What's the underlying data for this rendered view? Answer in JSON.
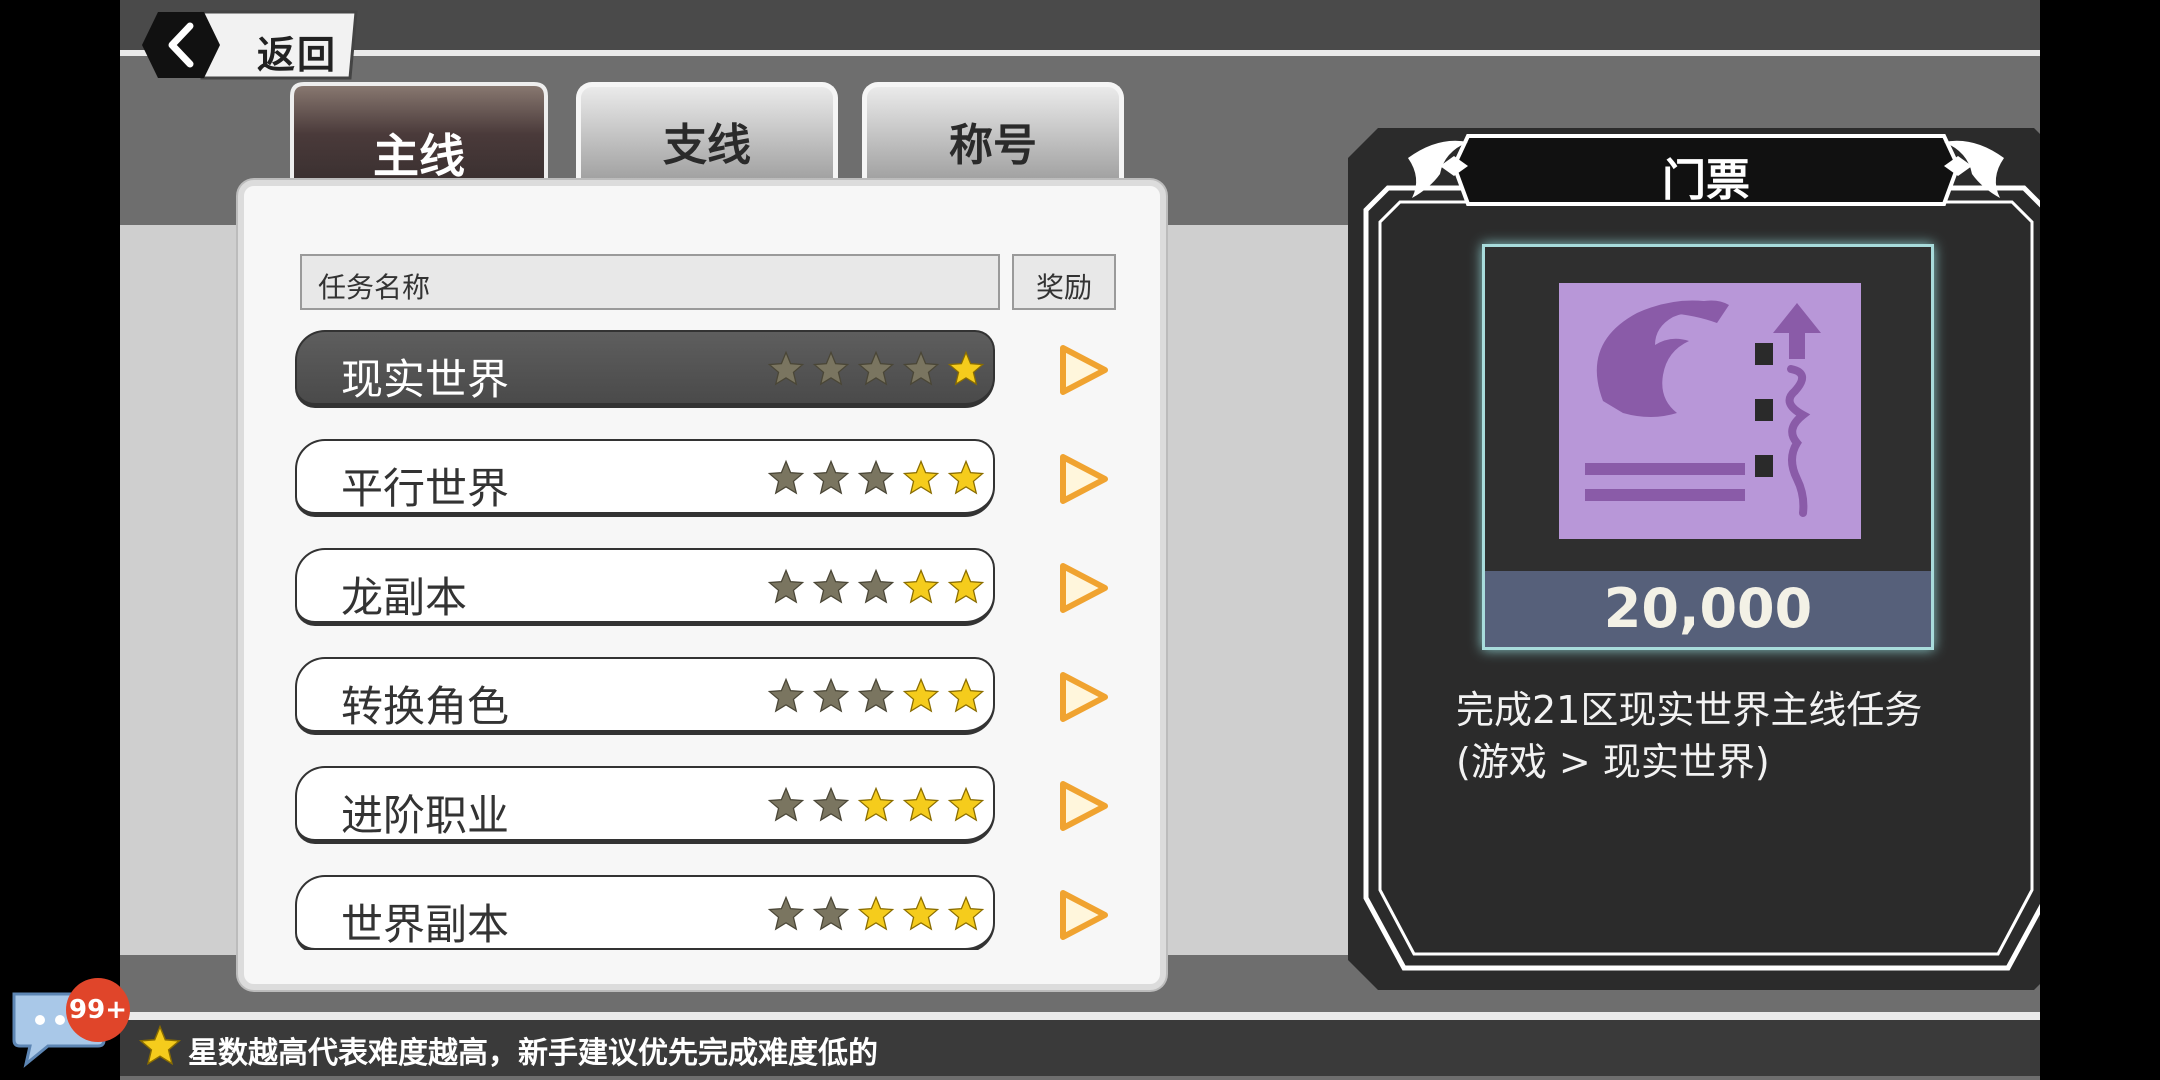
{
  "header": {
    "back_label": "返回"
  },
  "tabs": [
    {
      "label": "主线",
      "active": true
    },
    {
      "label": "支线",
      "active": false
    },
    {
      "label": "称号",
      "active": false
    }
  ],
  "list": {
    "name_header": "任务名称",
    "reward_header": "奖励",
    "quests": [
      {
        "name": "现实世界",
        "stars_filled": 1,
        "stars_total": 5,
        "selected": true
      },
      {
        "name": "平行世界",
        "stars_filled": 2,
        "stars_total": 5,
        "selected": false
      },
      {
        "name": "龙副本",
        "stars_filled": 2,
        "stars_total": 5,
        "selected": false
      },
      {
        "name": "转换角色",
        "stars_filled": 2,
        "stars_total": 5,
        "selected": false
      },
      {
        "name": "进阶职业",
        "stars_filled": 3,
        "stars_total": 5,
        "selected": false
      },
      {
        "name": "世界副本",
        "stars_filled": 3,
        "stars_total": 5,
        "selected": false
      }
    ]
  },
  "ticket": {
    "title": "门票",
    "amount": "20,000",
    "desc_line1": "完成21区现实世界主线任务",
    "desc_line2": "(游戏 > 现实世界)"
  },
  "tip": {
    "text": "星数越高代表难度越高，新手建议优先完成难度低的"
  },
  "chat": {
    "badge": "99+"
  },
  "colors": {
    "star_filled": "#f5cc1c",
    "star_empty": "#7a7560",
    "play_arrow": "#f0a330",
    "ticket_icon": "#b897d8"
  }
}
